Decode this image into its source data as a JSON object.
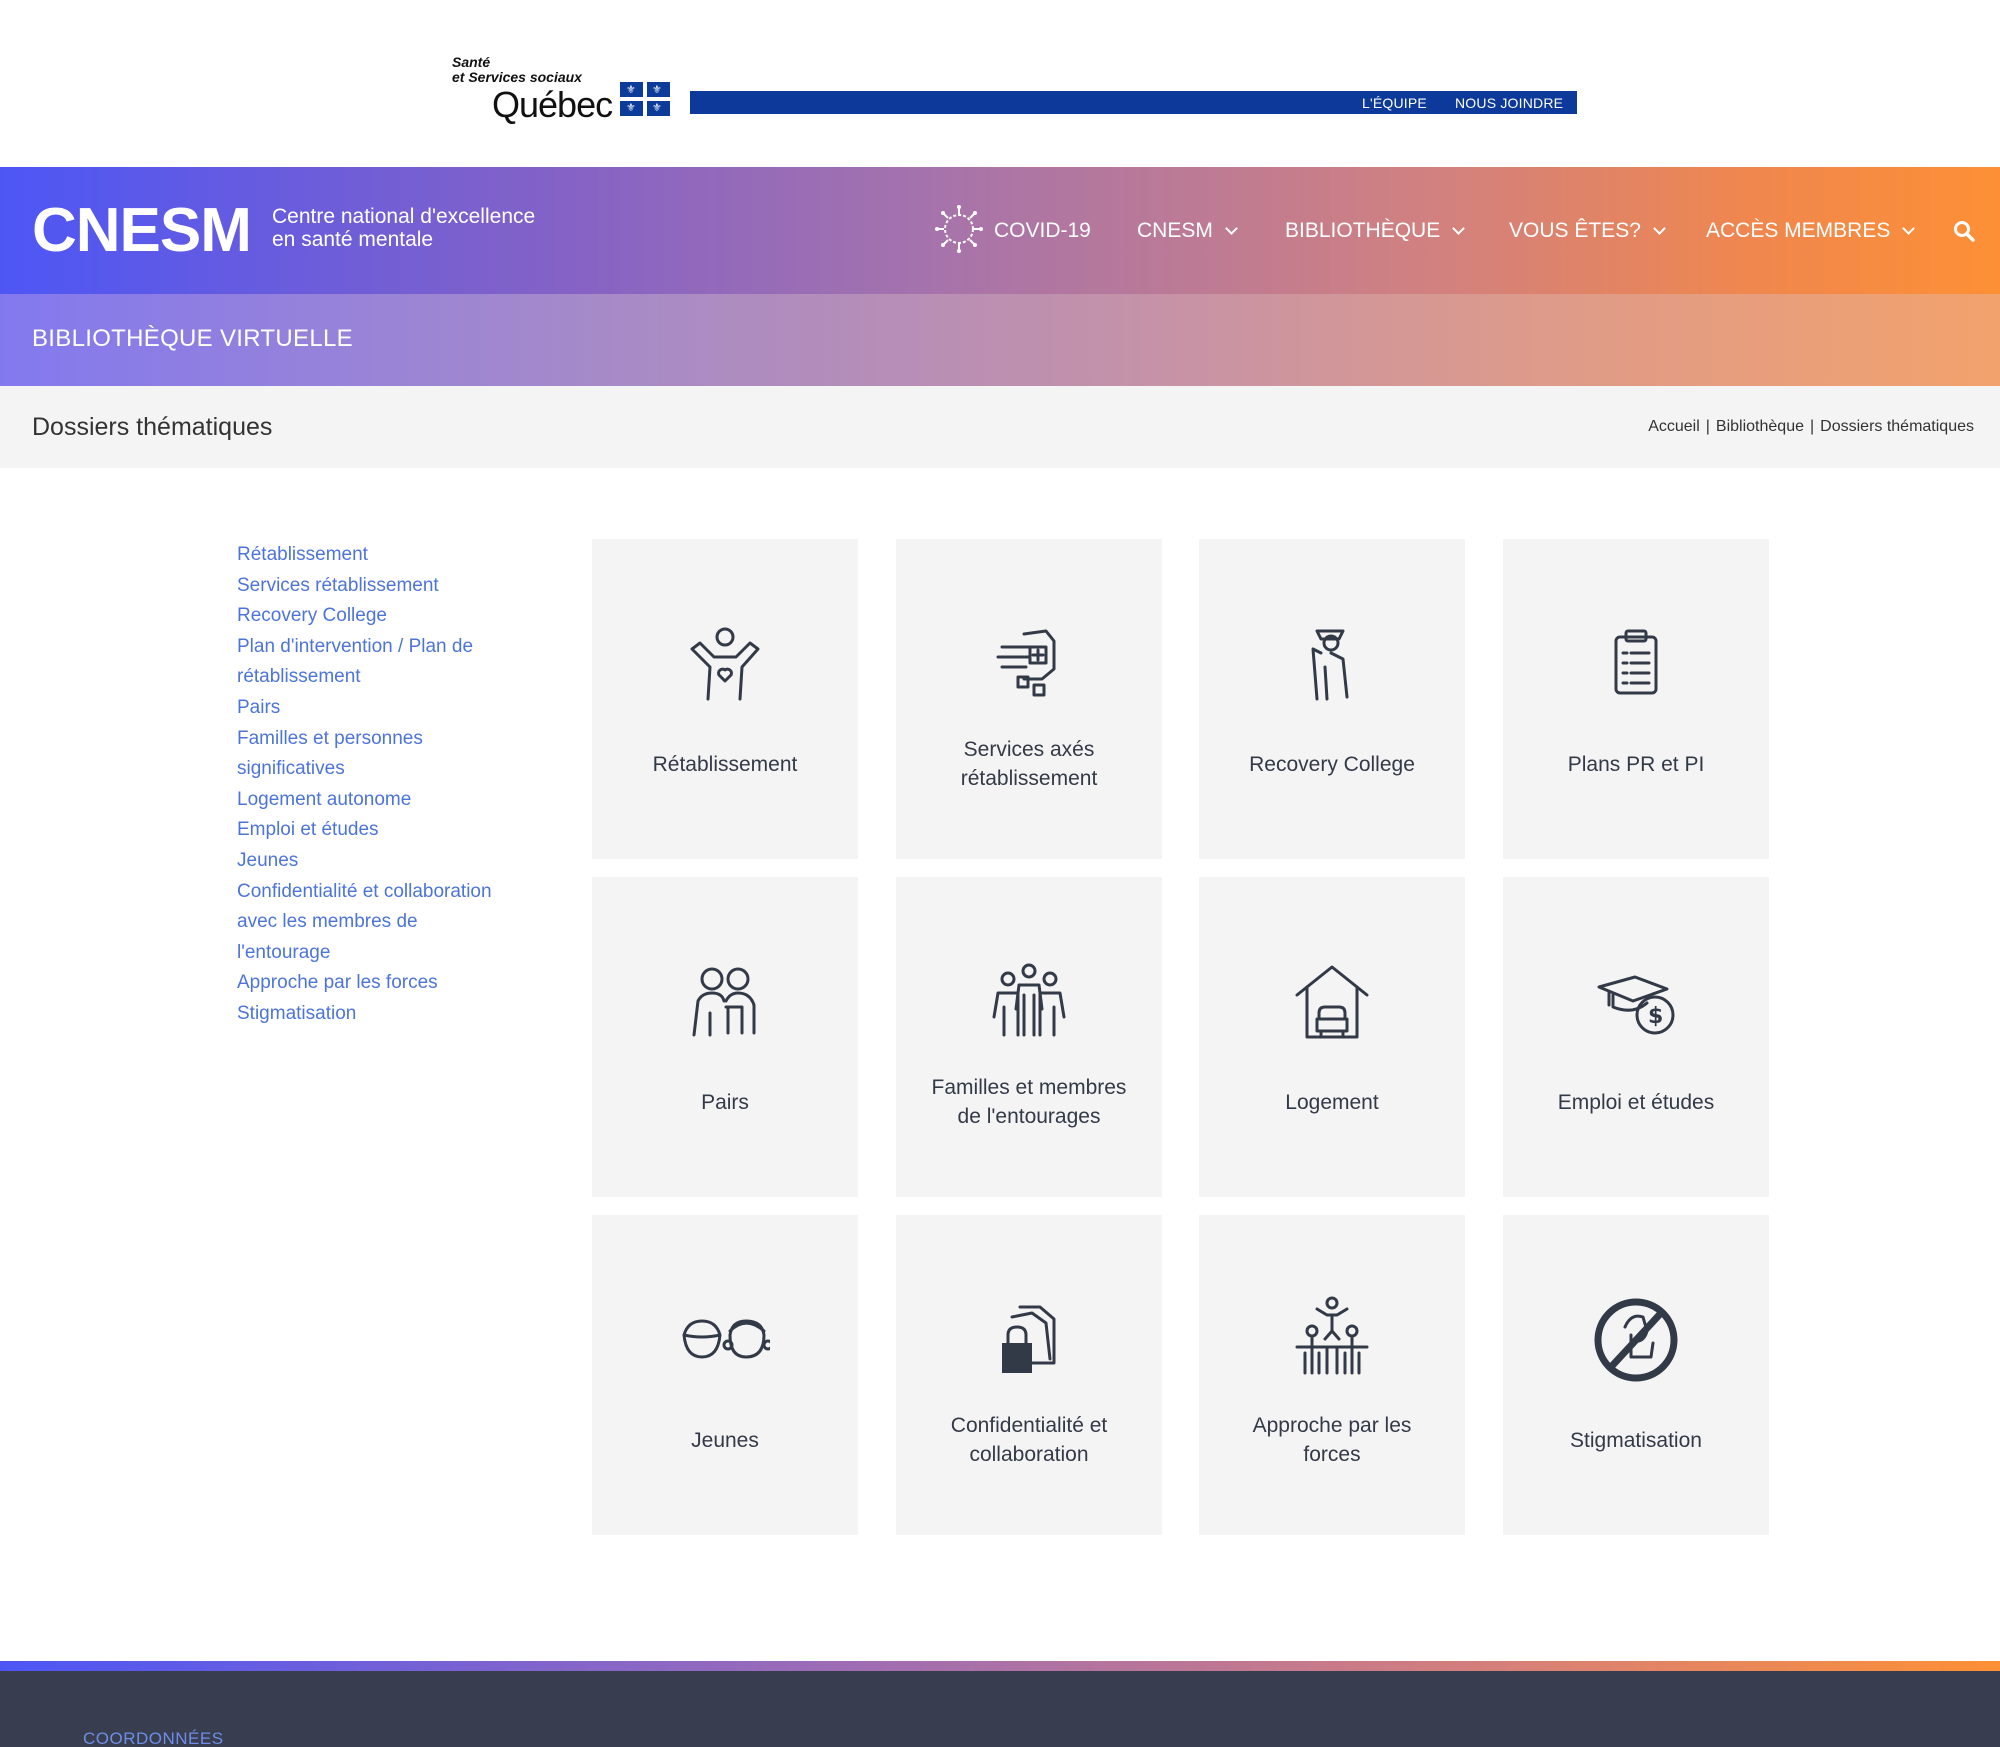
{
  "gov": {
    "logo_line1": "Santé",
    "logo_line2": "et Services sociaux",
    "logo_line3": "Québec",
    "links": [
      "L'ÉQUIPE",
      "NOUS JOINDRE"
    ]
  },
  "header": {
    "brand": "CNESM",
    "brand_sub1": "Centre national d'excellence",
    "brand_sub2": "en santé mentale",
    "nav": [
      {
        "label": "COVID-19"
      },
      {
        "label": "CNESM"
      },
      {
        "label": "BIBLIOTHÈQUE"
      },
      {
        "label": "VOUS ÊTES?"
      },
      {
        "label": "ACCÈS MEMBRES"
      }
    ]
  },
  "band": {
    "title": "BIBLIOTHÈQUE VIRTUELLE"
  },
  "page": {
    "title": "Dossiers thématiques",
    "breadcrumb": [
      "Accueil",
      "Bibliothèque",
      "Dossiers thématiques"
    ],
    "breadcrumb_sep": "|"
  },
  "sidebar": {
    "links": [
      [
        "Rétablissement"
      ],
      [
        "Services rétablissement"
      ],
      [
        "Recovery College"
      ],
      [
        "Plan d'intervention / Plan de",
        "rétablissement"
      ],
      [
        "Pairs"
      ],
      [
        "Familles et personnes",
        "significatives"
      ],
      [
        "Logement autonome"
      ],
      [
        "Emploi et études"
      ],
      [
        "Jeunes"
      ],
      [
        "Confidentialité et collaboration",
        "avec les membres de",
        "l'entourage"
      ],
      [
        "Approche par les forces"
      ],
      [
        "Stigmatisation"
      ]
    ]
  },
  "cards": [
    {
      "lines": [
        "Rétablissement"
      ],
      "icon": "person-heart-icon"
    },
    {
      "lines": [
        "Services axés",
        "rétablissement"
      ],
      "icon": "hand-health-icon"
    },
    {
      "lines": [
        "Recovery College"
      ],
      "icon": "graduate-icon"
    },
    {
      "lines": [
        "Plans PR et PI"
      ],
      "icon": "clipboard-icon"
    },
    {
      "lines": [
        "Pairs"
      ],
      "icon": "peers-icon"
    },
    {
      "lines": [
        "Familles et membres",
        "de l'entourages"
      ],
      "icon": "family-icon"
    },
    {
      "lines": [
        "Logement"
      ],
      "icon": "house-icon"
    },
    {
      "lines": [
        "Emploi et études"
      ],
      "icon": "grad-cap-money-icon"
    },
    {
      "lines": [
        "Jeunes"
      ],
      "icon": "youth-faces-icon"
    },
    {
      "lines": [
        "Confidentialité et",
        "collaboration"
      ],
      "icon": "lock-documents-icon"
    },
    {
      "lines": [
        "Approche par les",
        "forces"
      ],
      "icon": "people-pyramid-icon"
    },
    {
      "lines": [
        "Stigmatisation"
      ],
      "icon": "no-stigma-icon"
    }
  ],
  "footer": {
    "title": "COORDONNÉES"
  },
  "colors": {
    "link": "#4d74d9",
    "gov_blue": "#0c399a",
    "icon": "#333a47",
    "footer_bg": "#383e50"
  }
}
